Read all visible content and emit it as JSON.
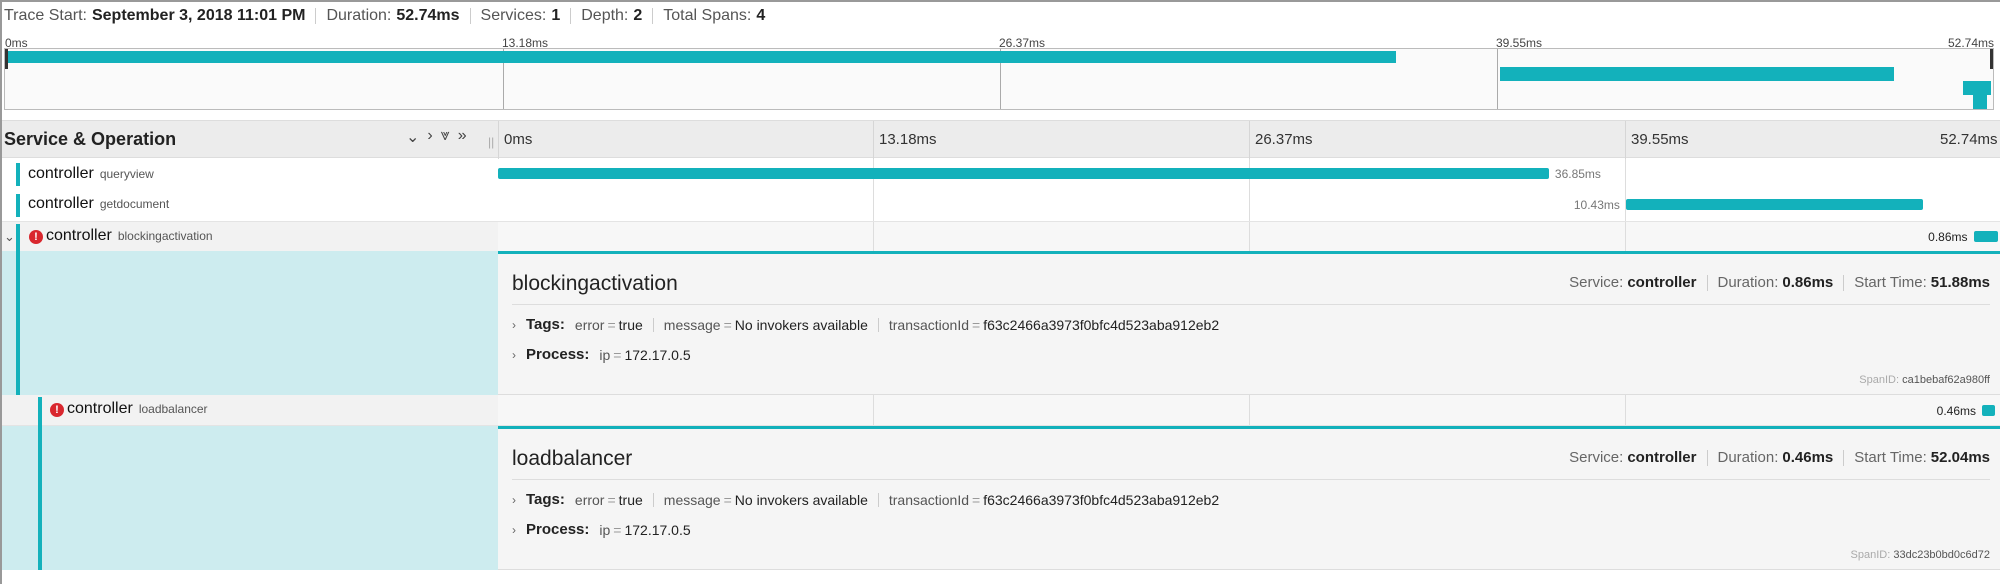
{
  "trace_header": {
    "trace_start_label": "Trace Start:",
    "trace_start_value": "September 3, 2018 11:01 PM",
    "duration_label": "Duration:",
    "duration_value": "52.74ms",
    "services_label": "Services:",
    "services_value": "1",
    "depth_label": "Depth:",
    "depth_value": "2",
    "total_spans_label": "Total Spans:",
    "total_spans_value": "4"
  },
  "minimap": {
    "ticks": [
      "0ms",
      "13.18ms",
      "26.37ms",
      "39.55ms",
      "52.74ms"
    ]
  },
  "timeline_header": {
    "title": "Service & Operation",
    "ticks": [
      "0ms",
      "13.18ms",
      "26.37ms",
      "39.55ms",
      "52.74ms"
    ],
    "controls": [
      "⌄",
      "›",
      "⩔",
      "»"
    ]
  },
  "spans": [
    {
      "service": "controller",
      "operation": "queryview",
      "start_ms": 0.0,
      "duration_label": "36.85ms",
      "duration_ms": 36.85,
      "error": false,
      "depth": 0
    },
    {
      "service": "controller",
      "operation": "getdocument",
      "start_ms": 39.55,
      "duration_label": "10.43ms",
      "duration_ms": 10.43,
      "error": false,
      "depth": 0
    },
    {
      "service": "controller",
      "operation": "blockingactivation",
      "start_ms": 51.88,
      "duration_label": "0.86ms",
      "duration_ms": 0.86,
      "error": true,
      "depth": 0,
      "expanded": true
    },
    {
      "service": "controller",
      "operation": "loadbalancer",
      "start_ms": 52.04,
      "duration_label": "0.46ms",
      "duration_ms": 0.46,
      "error": true,
      "depth": 1,
      "expanded": true
    }
  ],
  "details": [
    {
      "title": "blockingactivation",
      "service_label": "Service:",
      "service_value": "controller",
      "duration_label": "Duration:",
      "duration_value": "0.86ms",
      "start_label": "Start Time:",
      "start_value": "51.88ms",
      "tags_label": "Tags:",
      "tags": [
        {
          "k": "error",
          "v": "true"
        },
        {
          "k": "message",
          "v": "No invokers available"
        },
        {
          "k": "transactionId",
          "v": "f63c2466a3973f0bfc4d523aba912eb2"
        }
      ],
      "process_label": "Process:",
      "process": [
        {
          "k": "ip",
          "v": "172.17.0.5"
        }
      ],
      "span_id_label": "SpanID:",
      "span_id_value": "ca1bebaf62a980ff"
    },
    {
      "title": "loadbalancer",
      "service_label": "Service:",
      "service_value": "controller",
      "duration_label": "Duration:",
      "duration_value": "0.46ms",
      "start_label": "Start Time:",
      "start_value": "52.04ms",
      "tags_label": "Tags:",
      "tags": [
        {
          "k": "error",
          "v": "true"
        },
        {
          "k": "message",
          "v": "No invokers available"
        },
        {
          "k": "transactionId",
          "v": "f63c2466a3973f0bfc4d523aba912eb2"
        }
      ],
      "process_label": "Process:",
      "process": [
        {
          "k": "ip",
          "v": "172.17.0.5"
        }
      ],
      "span_id_label": "SpanID:",
      "span_id_value": "33dc23b0bd0c6d72"
    }
  ],
  "colors": {
    "accent": "#13b1bb",
    "error": "#d9272e",
    "detail_fill": "#cdecef"
  },
  "icons": {
    "error": "error-icon",
    "expand": "chevron-down-icon",
    "collapse_arrow": "chevron-right-icon"
  }
}
